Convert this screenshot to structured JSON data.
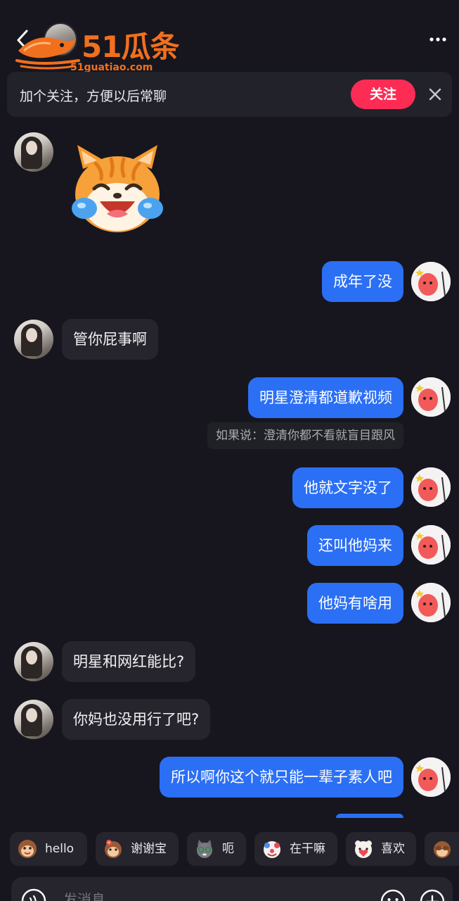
{
  "header": {
    "logo_text": "51瓜条",
    "logo_url": "51guatiao.com"
  },
  "follow_banner": {
    "text": "加个关注，方便以后常聊",
    "button_label": "关注"
  },
  "messages": [
    {
      "side": "left",
      "type": "sticker",
      "sticker": "crying-laughing-cat"
    },
    {
      "side": "right",
      "text": "成年了没"
    },
    {
      "side": "left",
      "text": "管你屁事啊"
    },
    {
      "side": "right",
      "text": "明星澄清都道歉视频"
    },
    {
      "side": "system",
      "text": "如果说：澄清你都不看就盲目跟风"
    },
    {
      "side": "right",
      "text": "他就文字没了"
    },
    {
      "side": "right",
      "text": "还叫他妈来"
    },
    {
      "side": "right",
      "text": "他妈有啥用"
    },
    {
      "side": "left",
      "text": "明星和网红能比?"
    },
    {
      "side": "left",
      "text": "你妈也没用行了吧?"
    },
    {
      "side": "right",
      "text": "所以啊你这个就只能一辈子素人吧"
    }
  ],
  "quick_replies": [
    {
      "label": "hello",
      "icon": "monkey-emoji"
    },
    {
      "label": "谢谢宝",
      "icon": "monkey-flower-emoji"
    },
    {
      "label": "呃",
      "icon": "cat-glasses-emoji"
    },
    {
      "label": "在干嘛",
      "icon": "clown-emoji"
    },
    {
      "label": "喜欢",
      "icon": "bear-heart-emoji"
    },
    {
      "label": "",
      "icon": "monkey-covering-eyes-emoji"
    }
  ],
  "input": {
    "placeholder": "发消息"
  },
  "colors": {
    "background": "#17161e",
    "my_bubble": "#2b6ff5",
    "their_bubble": "#26252d",
    "follow_button": "#fe2c55",
    "logo": "#f0701e"
  }
}
